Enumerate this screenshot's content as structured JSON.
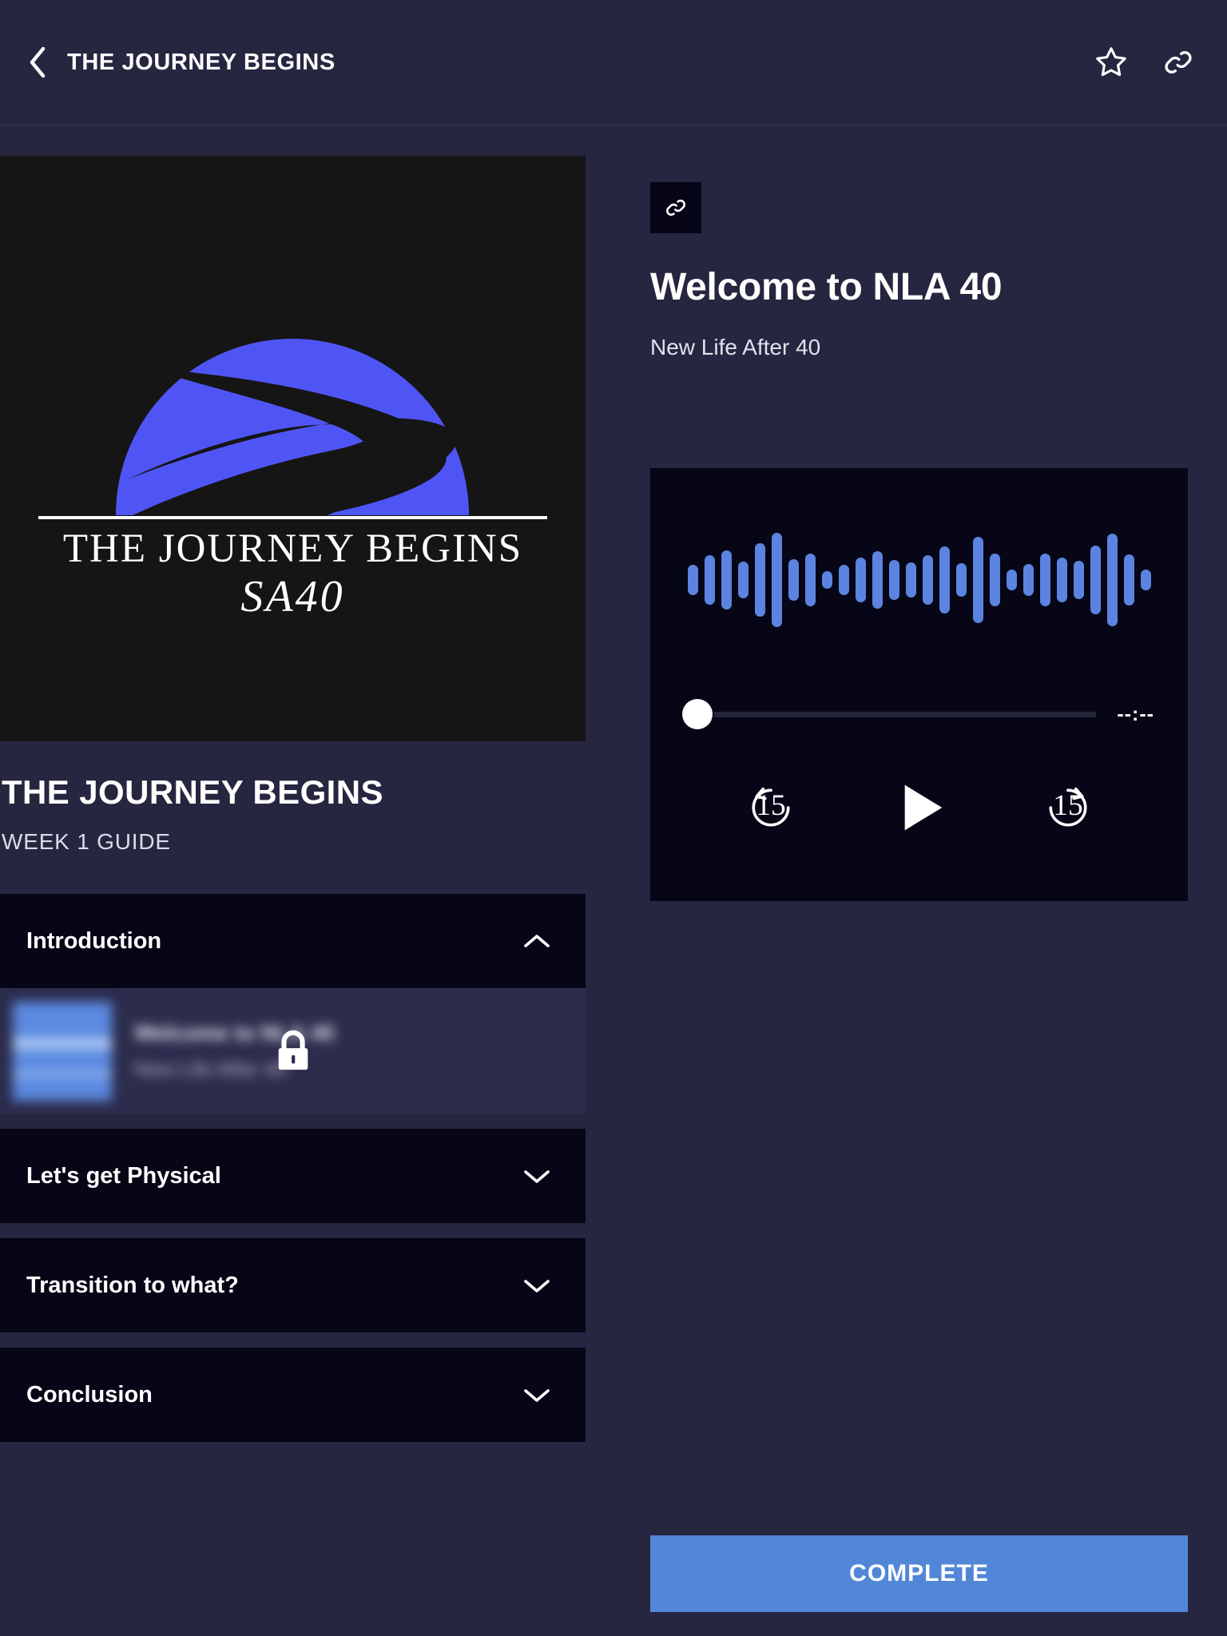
{
  "appbar": {
    "title": "THE JOURNEY BEGINS",
    "back_icon": "chevron-left-icon",
    "favorite_icon": "star-outline-icon",
    "share_icon": "link-icon"
  },
  "artwork": {
    "title": "THE JOURNEY BEGINS",
    "subtitle": "SA40",
    "alt": "blue-semicircle-winding-road-logo",
    "background_color": "#151515",
    "accent_color": "#4f55f5"
  },
  "course": {
    "title": "THE JOURNEY BEGINS",
    "subtitle": "WEEK 1 GUIDE"
  },
  "accordion": {
    "sections": [
      {
        "label": "Introduction",
        "expanded": true,
        "chevron": "chevron-up-icon",
        "items": [
          {
            "title": "Welcome to NLA 40",
            "subtitle": "New Life After 40",
            "locked": true,
            "lock_icon": "lock-icon"
          }
        ]
      },
      {
        "label": "Let's get Physical",
        "expanded": false,
        "chevron": "chevron-down-icon",
        "items": []
      },
      {
        "label": "Transition to what?",
        "expanded": false,
        "chevron": "chevron-down-icon",
        "items": []
      },
      {
        "label": "Conclusion",
        "expanded": false,
        "chevron": "chevron-down-icon",
        "items": []
      }
    ]
  },
  "episode": {
    "link_icon": "link-icon",
    "title": "Welcome to NLA 40",
    "subtitle": "New Life After 40"
  },
  "player": {
    "time_display": "--:--",
    "progress_percent": 0,
    "rewind_label": "15",
    "forward_label": "15",
    "rewind_icon": "rewind-15-icon",
    "play_icon": "play-icon",
    "forward_icon": "forward-15-icon",
    "waveform_color": "#5b84e0",
    "background_color": "#060617",
    "waveform": [
      38,
      62,
      74,
      46,
      92,
      118,
      52,
      66,
      22,
      38,
      56,
      72,
      50,
      44,
      62,
      84,
      42,
      108,
      66,
      26,
      40,
      66,
      56,
      48,
      86,
      116,
      64,
      26
    ]
  },
  "footer": {
    "complete_label": "COMPLETE",
    "complete_color": "#5287d8"
  }
}
